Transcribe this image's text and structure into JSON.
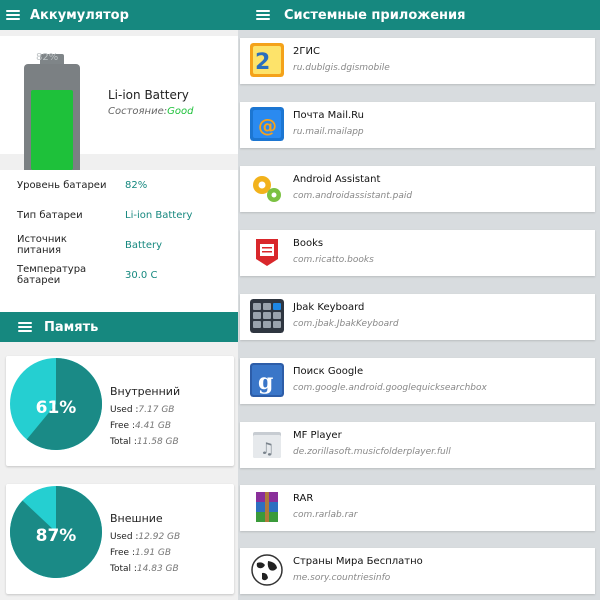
{
  "battery_screen": {
    "title": "Аккумулятор",
    "battery_name": "Li-ion Battery",
    "state_label": "Состояние:",
    "state_value": "Good",
    "level_fraction": 0.82,
    "info_rows": [
      {
        "label": "Уровень батареи",
        "value": "82%"
      },
      {
        "label": "Тип батареи",
        "value": "Li-ion Battery"
      },
      {
        "label": "Источник питания",
        "value": "Battery"
      },
      {
        "label": "Температура батареи",
        "value": "30.0 C"
      }
    ]
  },
  "memory": {
    "title": "Память",
    "cards": [
      {
        "name": "Внутренний",
        "percent_label": "61%",
        "used_fraction": 0.61,
        "used_label": "Used :",
        "used": "7.17 GB",
        "free_label": "Free :",
        "free": "4.41 GB",
        "total_label": "Total :",
        "total": "11.58 GB"
      },
      {
        "name": "Внешние",
        "percent_label": "87%",
        "used_fraction": 0.87,
        "used_label": "Used :",
        "used": "12.92 GB",
        "free_label": "Free :",
        "free": "1.91 GB",
        "total_label": "Total :",
        "total": "14.83 GB"
      }
    ]
  },
  "system_apps": {
    "title": "Системные приложения",
    "apps": [
      {
        "name": "2ГИС",
        "package": "ru.dublgis.dgismobile",
        "icon": "2gis-icon"
      },
      {
        "name": "Почта Mail.Ru",
        "package": "ru.mail.mailapp",
        "icon": "mail-icon"
      },
      {
        "name": "Android Assistant",
        "package": "com.androidassistant.paid",
        "icon": "gears-icon"
      },
      {
        "name": "Books",
        "package": "com.ricatto.books",
        "icon": "books-icon"
      },
      {
        "name": "Jbak Keyboard",
        "package": "com.jbak.JbakKeyboard",
        "icon": "keyboard-icon"
      },
      {
        "name": "Поиск Google",
        "package": "com.google.android.googlequicksearchbox",
        "icon": "google-icon"
      },
      {
        "name": "MF Player",
        "package": "de.zorillasoft.musicfolderplayer.full",
        "icon": "music-folder-icon"
      },
      {
        "name": "RAR",
        "package": "com.rarlab.rar",
        "icon": "rar-icon"
      },
      {
        "name": "Страны Мира Бесплатно",
        "package": "me.sory.countriesinfo",
        "icon": "globe-icon"
      }
    ]
  },
  "colors": {
    "accent": "#16887f",
    "pie_used": "#1a8a86",
    "pie_free": "#25cfd1",
    "battery_fill": "#1ec13a"
  }
}
